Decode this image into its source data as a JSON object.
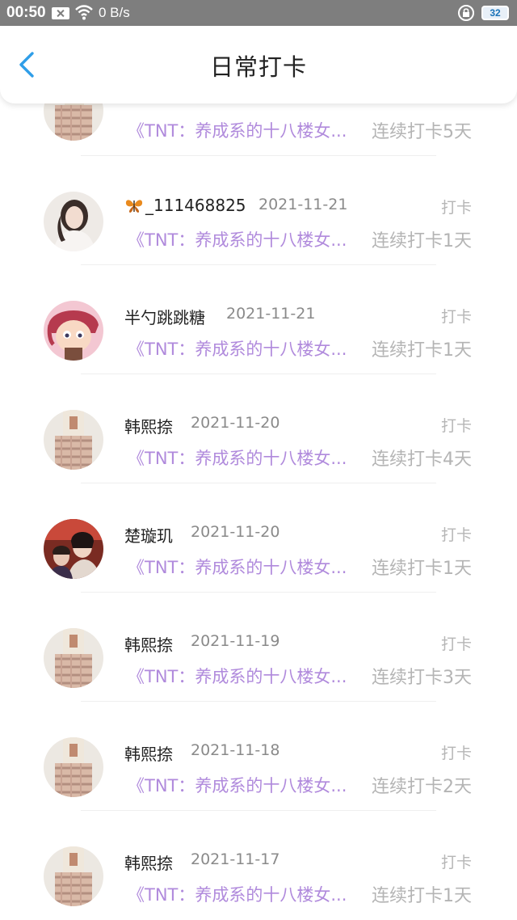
{
  "status_bar": {
    "time": "00:50",
    "network_speed": "0 B/s",
    "battery": "32"
  },
  "header": {
    "title": "日常打卡",
    "back_icon": "chevron-left-icon"
  },
  "records": [
    {
      "name": "",
      "date": "",
      "tag": "",
      "book": "《TNT：养成系的十八楼女...",
      "streak": "连续打卡5天",
      "avatar": "girl-plaid-skirt"
    },
    {
      "name": "_111468825",
      "name_prefix_icon": "butterfly-icon",
      "date": "2021-11-21",
      "tag": "打卡",
      "book": "《TNT：养成系的十八楼女...",
      "streak": "连续打卡1天",
      "avatar": "girl-portrait"
    },
    {
      "name": "半勺跳跳糖",
      "date": "2021-11-21",
      "tag": "打卡",
      "book": "《TNT：养成系的十八楼女...",
      "streak": "连续打卡1天",
      "avatar": "cartoon-girl"
    },
    {
      "name": "韩熙捺",
      "date": "2021-11-20",
      "tag": "打卡",
      "book": "《TNT：养成系的十八楼女...",
      "streak": "连续打卡4天",
      "avatar": "girl-plaid-skirt"
    },
    {
      "name": "楚璇玑",
      "date": "2021-11-20",
      "tag": "打卡",
      "book": "《TNT：养成系的十八楼女...",
      "streak": "连续打卡1天",
      "avatar": "drama-poster"
    },
    {
      "name": "韩熙捺",
      "date": "2021-11-19",
      "tag": "打卡",
      "book": "《TNT：养成系的十八楼女...",
      "streak": "连续打卡3天",
      "avatar": "girl-plaid-skirt"
    },
    {
      "name": "韩熙捺",
      "date": "2021-11-18",
      "tag": "打卡",
      "book": "《TNT：养成系的十八楼女...",
      "streak": "连续打卡2天",
      "avatar": "girl-plaid-skirt"
    },
    {
      "name": "韩熙捺",
      "date": "2021-11-17",
      "tag": "打卡",
      "book": "《TNT：养成系的十八楼女...",
      "streak": "连续打卡1天",
      "avatar": "girl-plaid-skirt"
    }
  ],
  "colors": {
    "accent": "#2f9ee8",
    "book_title": "#b08adc",
    "secondary_text": "#b4b4b4",
    "status_bar": "#7e7e7e"
  }
}
